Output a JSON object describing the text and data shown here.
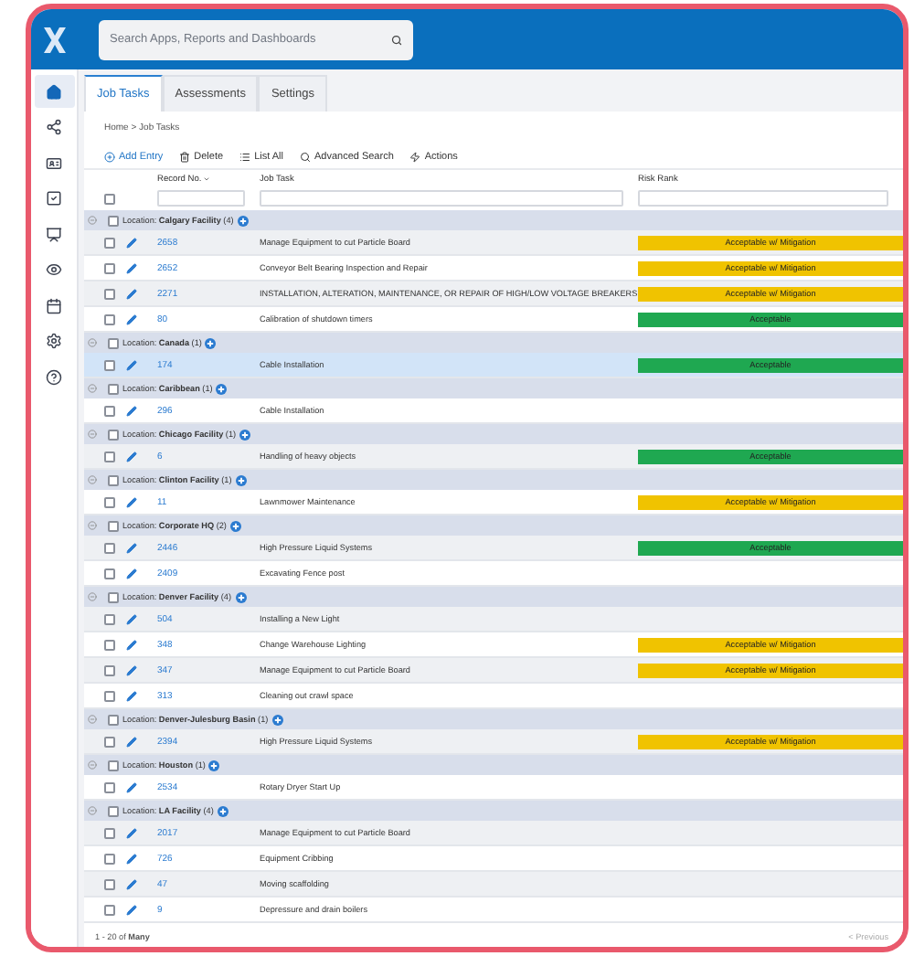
{
  "header": {
    "search": {
      "placeholder": "Search Apps, Reports and Dashboards"
    }
  },
  "sidebar": {
    "items": [
      {
        "kind": "home",
        "selected": true
      },
      {
        "kind": "nodes",
        "selected": false
      },
      {
        "kind": "card",
        "selected": false
      },
      {
        "kind": "check",
        "selected": false
      },
      {
        "kind": "board",
        "selected": false
      },
      {
        "kind": "eye",
        "selected": false
      },
      {
        "kind": "calendar",
        "selected": false
      },
      {
        "kind": "gear",
        "selected": false
      },
      {
        "kind": "help",
        "selected": false
      }
    ]
  },
  "tabs": [
    {
      "label": "Job Tasks",
      "selected": true
    },
    {
      "label": "Assessments",
      "selected": false
    },
    {
      "label": "Settings",
      "selected": false
    }
  ],
  "breadcrumb": "Home > Job Tasks",
  "toolbar": [
    {
      "kind": "add",
      "label": "Add Entry"
    },
    {
      "kind": "delete",
      "label": "Delete"
    },
    {
      "kind": "list",
      "label": "List All"
    },
    {
      "kind": "search",
      "label": "Advanced Search"
    },
    {
      "kind": "actions",
      "label": "Actions"
    }
  ],
  "table": {
    "select_all_checked": false,
    "columns": [
      {
        "label": "Record No.",
        "sorted": true
      },
      {
        "label": "Job Task",
        "sorted": false
      },
      {
        "label": "Risk Rank",
        "sorted": false
      }
    ],
    "groups": [
      {
        "label": "Location: **Calgary Facility** (4)",
        "expanded": true,
        "checked": false,
        "rows": [
          {
            "record": "2658",
            "task": "Manage Equipment to cut Particle Board",
            "selected": false,
            "risk": {
              "label": "Acceptable w/ Mitigation",
              "color": "#f0c300"
            }
          },
          {
            "record": "2652",
            "task": "Conveyor Belt Bearing Inspection and Repair",
            "selected": false,
            "risk": {
              "label": "Acceptable w/ Mitigation",
              "color": "#f0c300"
            }
          },
          {
            "record": "2271",
            "task": "INSTALLATION, ALTERATION, MAINTENANCE, OR REPAIR OF HIGH/LOW VOLTAGE BREAKERS",
            "selected": false,
            "risk": {
              "label": "Acceptable w/ Mitigation",
              "color": "#f0c300"
            }
          },
          {
            "record": "80",
            "task": "Calibration of shutdown timers",
            "selected": false,
            "risk": {
              "label": "Acceptable",
              "color": "#1fa851"
            }
          }
        ]
      },
      {
        "label": "Location: **Canada** (1)",
        "expanded": true,
        "checked": false,
        "rows": [
          {
            "record": "174",
            "task": "Cable Installation",
            "selected": true,
            "risk": {
              "label": "Acceptable",
              "color": "#1fa851"
            }
          }
        ]
      },
      {
        "label": "Location: **Caribbean** (1)",
        "expanded": true,
        "checked": false,
        "rows": [
          {
            "record": "296",
            "task": "Cable Installation",
            "selected": false
          }
        ]
      },
      {
        "label": "Location: **Chicago Facility** (1)",
        "expanded": true,
        "checked": false,
        "rows": [
          {
            "record": "6",
            "task": "Handling of heavy objects",
            "selected": false,
            "risk": {
              "label": "Acceptable",
              "color": "#1fa851"
            }
          }
        ]
      },
      {
        "label": "Location: **Clinton Facility** (1)",
        "expanded": true,
        "checked": false,
        "rows": [
          {
            "record": "11",
            "task": "Lawnmower Maintenance",
            "selected": false,
            "risk": {
              "label": "Acceptable w/ Mitigation",
              "color": "#f0c300"
            }
          }
        ]
      },
      {
        "label": "Location: **Corporate HQ** (2)",
        "expanded": true,
        "checked": false,
        "rows": [
          {
            "record": "2446",
            "task": "High Pressure Liquid Systems",
            "selected": false,
            "risk": {
              "label": "Acceptable",
              "color": "#1fa851"
            }
          },
          {
            "record": "2409",
            "task": "Excavating Fence post",
            "selected": false
          }
        ]
      },
      {
        "label": "Location: **Denver Facility** (4)",
        "expanded": true,
        "checked": false,
        "rows": [
          {
            "record": "504",
            "task": "Installing a New Light",
            "selected": false
          },
          {
            "record": "348",
            "task": "Change Warehouse Lighting",
            "selected": false,
            "risk": {
              "label": "Acceptable w/ Mitigation",
              "color": "#f0c300"
            }
          },
          {
            "record": "347",
            "task": "Manage Equipment to cut Particle Board",
            "selected": false,
            "risk": {
              "label": "Acceptable w/ Mitigation",
              "color": "#f0c300"
            }
          },
          {
            "record": "313",
            "task": "Cleaning out crawl space",
            "selected": false
          }
        ]
      },
      {
        "label": "Location: **Denver-Julesburg Basin** (1)",
        "expanded": true,
        "checked": false,
        "rows": [
          {
            "record": "2394",
            "task": "High Pressure Liquid Systems",
            "selected": false,
            "risk": {
              "label": "Acceptable w/ Mitigation",
              "color": "#f0c300"
            }
          }
        ]
      },
      {
        "label": "Location: **Houston** (1)",
        "expanded": true,
        "checked": false,
        "rows": [
          {
            "record": "2534",
            "task": "Rotary Dryer Start Up",
            "selected": false
          }
        ]
      },
      {
        "label": "Location: **LA Facility** (4)",
        "expanded": true,
        "checked": false,
        "rows": [
          {
            "record": "2017",
            "task": "Manage Equipment to cut Particle Board",
            "selected": false
          },
          {
            "record": "726",
            "task": "Equipment Cribbing",
            "selected": false
          },
          {
            "record": "47",
            "task": "Moving scaffolding",
            "selected": false
          },
          {
            "record": "9",
            "task": "Depressure and drain boilers",
            "selected": false
          }
        ]
      }
    ]
  },
  "footer": {
    "range": "1 - 20 of **Many**",
    "previous": "< Previous"
  }
}
